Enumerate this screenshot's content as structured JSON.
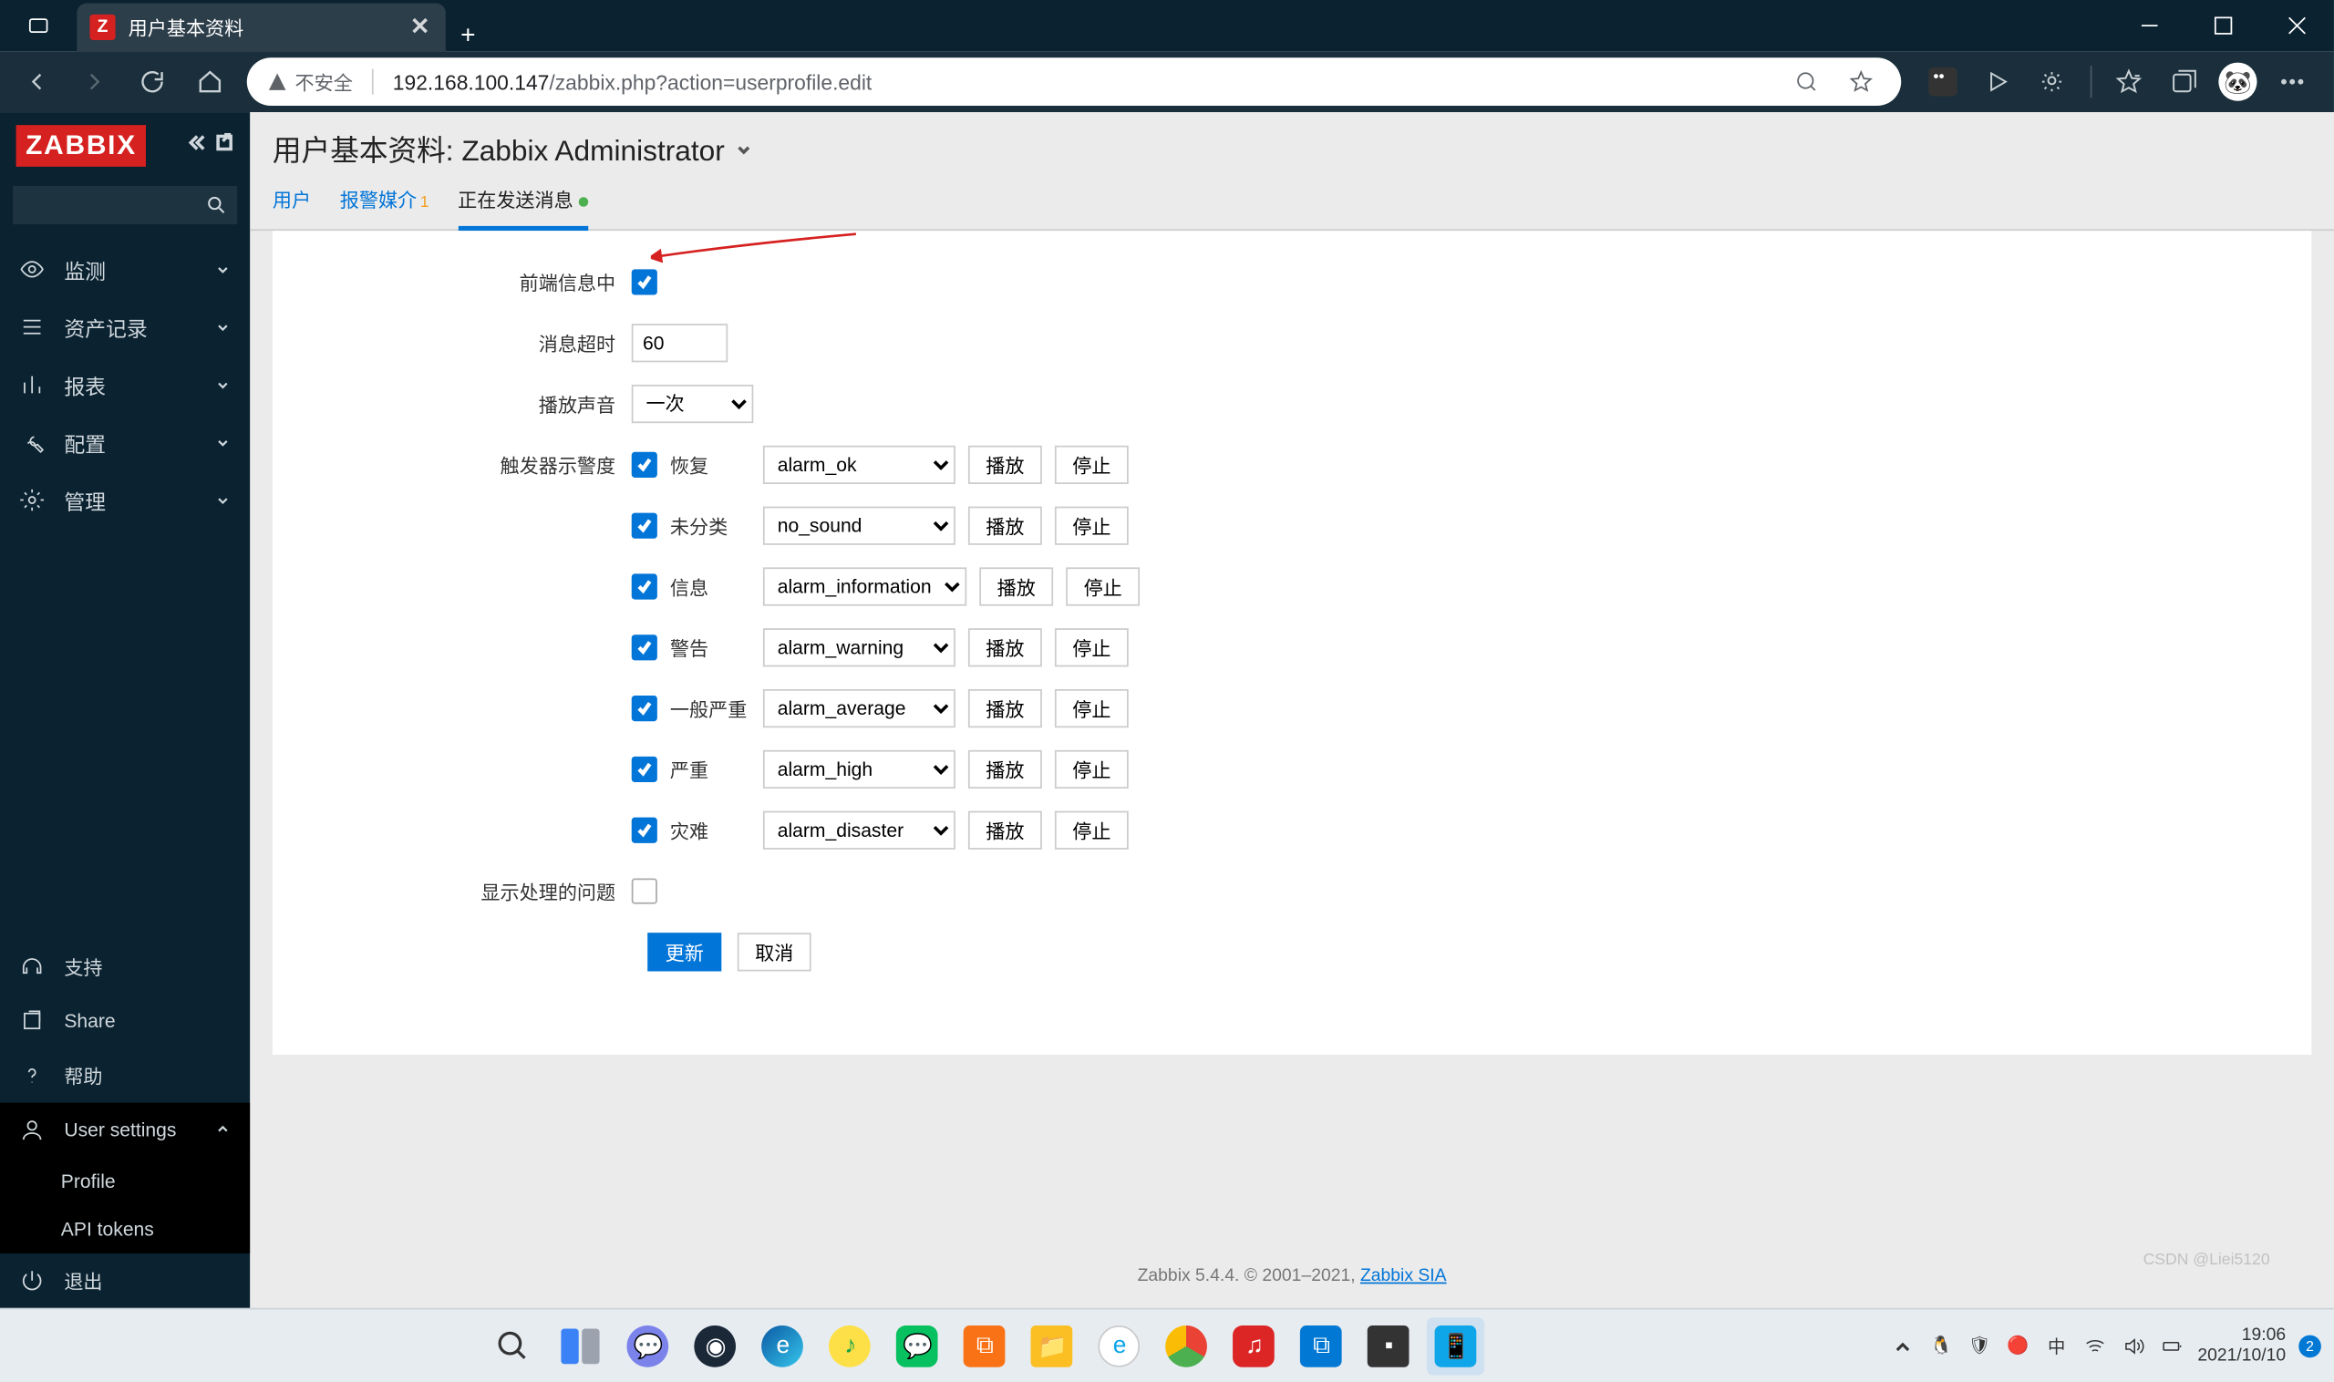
{
  "browser": {
    "tab_title": "用户基本资料",
    "favicon_letter": "Z",
    "secure_label": "不安全",
    "url_host": "192.168.100.147",
    "url_path": "/zabbix.php?action=userprofile.edit"
  },
  "sidebar": {
    "logo": "ZABBIX",
    "search_placeholder": "",
    "nav": [
      {
        "icon": "eye",
        "label": "监测"
      },
      {
        "icon": "list",
        "label": "资产记录"
      },
      {
        "icon": "bar",
        "label": "报表"
      },
      {
        "icon": "wrench",
        "label": "配置"
      },
      {
        "icon": "gear",
        "label": "管理"
      }
    ],
    "bottom": [
      {
        "icon": "headset",
        "label": "支持"
      },
      {
        "icon": "share",
        "label": "Share"
      },
      {
        "icon": "question",
        "label": "帮助"
      },
      {
        "icon": "user",
        "label": "User settings"
      },
      {
        "icon": "power",
        "label": "退出"
      }
    ],
    "user_sub": [
      {
        "label": "Profile"
      },
      {
        "label": "API tokens"
      }
    ]
  },
  "page": {
    "title": "用户基本资料: Zabbix Administrator",
    "tabs": [
      {
        "label": "用户"
      },
      {
        "label": "报警媒介",
        "sup": "1"
      },
      {
        "label": "正在发送消息",
        "dot": true
      }
    ],
    "form": {
      "frontend_label": "前端信息中",
      "frontend_on": true,
      "timeout_label": "消息超时",
      "timeout_value": "60",
      "sound_label": "播放声音",
      "sound_value": "一次",
      "severity_label": "触发器示警度",
      "play_btn": "播放",
      "stop_btn": "停止",
      "severities": [
        {
          "on": true,
          "name": "恢复",
          "sound": "alarm_ok"
        },
        {
          "on": true,
          "name": "未分类",
          "sound": "no_sound"
        },
        {
          "on": true,
          "name": "信息",
          "sound": "alarm_information"
        },
        {
          "on": true,
          "name": "警告",
          "sound": "alarm_warning"
        },
        {
          "on": true,
          "name": "一般严重",
          "sound": "alarm_average"
        },
        {
          "on": true,
          "name": "严重",
          "sound": "alarm_high"
        },
        {
          "on": true,
          "name": "灾难",
          "sound": "alarm_disaster"
        }
      ],
      "suppressed_label": "显示处理的问题",
      "suppressed_on": false,
      "update_btn": "更新",
      "cancel_btn": "取消"
    },
    "footer_text": "Zabbix 5.4.4. © 2001–2021, ",
    "footer_link": "Zabbix SIA"
  },
  "taskbar": {
    "time": "19:06",
    "date": "2021/10/10",
    "ime": "中",
    "notif_count": "2",
    "watermark": "CSDN @Liei5120"
  }
}
